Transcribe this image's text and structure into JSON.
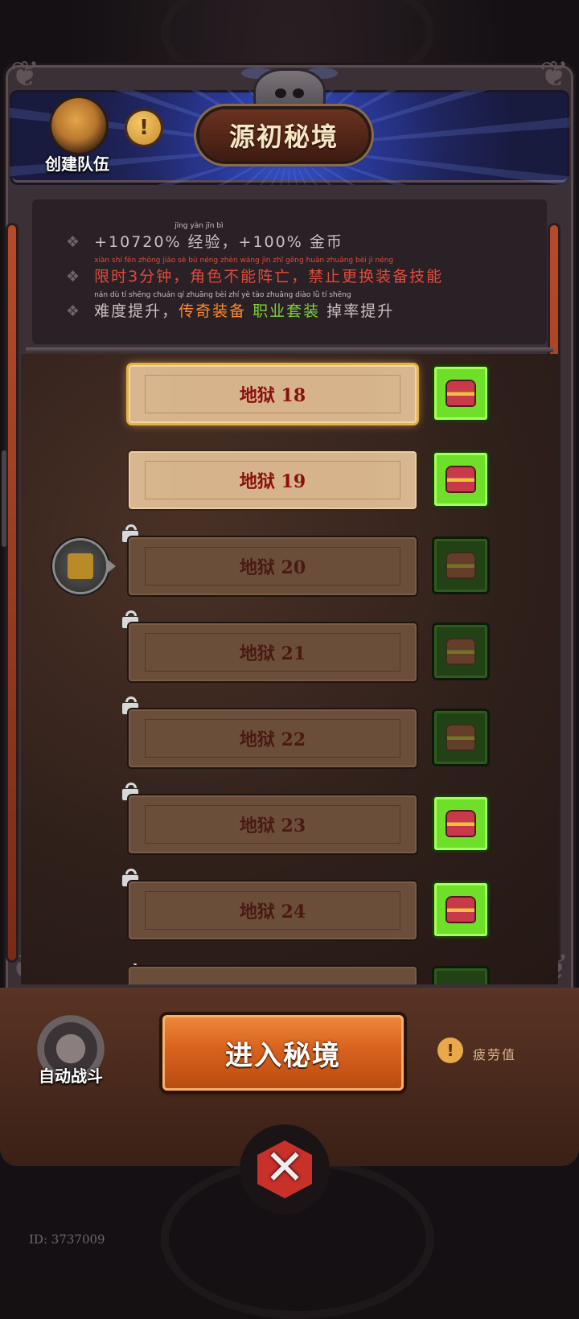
{
  "header": {
    "title": "源初秘境",
    "create_team": "创建队伍",
    "info_icon": "!"
  },
  "buffs": [
    {
      "text": "+10720% 经验，+100% 金币",
      "pinyin": "jīng yàn               jīn bì",
      "color": "#c9c0c2"
    },
    {
      "text": "限时3分钟，角色不能阵亡，禁止更换装备技能",
      "pinyin": "xiàn shí   fēn zhōng    jiǎo sè  bù  néng zhèn wáng   jìn  zhǐ gēng huàn zhuāng bèi  jì  néng",
      "color": "#e24a3a"
    },
    {
      "parts": [
        "难度提升，",
        "传奇装备",
        " ",
        "职业套装",
        " 掉率提升"
      ],
      "pinyin": "nán  dù  tí  shēng   chuán qí zhuāng bèi   zhí  yè  tào zhuāng  diào  lǜ  tí  shēng"
    }
  ],
  "levels": [
    {
      "label": "地狱 18",
      "locked": false,
      "selected": true,
      "reward_active": true
    },
    {
      "label": "地狱 19",
      "locked": false,
      "selected": false,
      "reward_active": true
    },
    {
      "label": "地狱 20",
      "locked": true,
      "selected": false,
      "reward_active": false
    },
    {
      "label": "地狱 21",
      "locked": true,
      "selected": false,
      "reward_active": false
    },
    {
      "label": "地狱 22",
      "locked": true,
      "selected": false,
      "reward_active": false
    },
    {
      "label": "地狱 23",
      "locked": true,
      "selected": false,
      "reward_active": true
    },
    {
      "label": "地狱 24",
      "locked": true,
      "selected": false,
      "reward_active": true
    }
  ],
  "footer": {
    "auto_battle": "自动战斗",
    "enter_button": "进入秘境",
    "fatigue_label": "疲劳值",
    "fatigue_icon": "!"
  },
  "close_icon": "✕",
  "user_id": "ID: 3737009",
  "colors": {
    "accent_orange": "#d8621e",
    "reward_green": "#6fe02a",
    "danger_red": "#e24a3a",
    "legendary_orange": "#ff8a2a",
    "set_green": "#7ed23a"
  }
}
